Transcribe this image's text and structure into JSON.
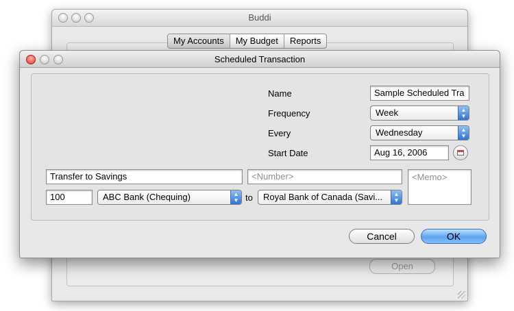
{
  "main_window": {
    "title": "Buddi",
    "tabs": [
      "My Accounts",
      "My Budget",
      "Reports"
    ],
    "open_button": "Open"
  },
  "dialog": {
    "title": "Scheduled Transaction",
    "name_label": "Name",
    "name_value": "Sample Scheduled Tra",
    "frequency_label": "Frequency",
    "frequency_value": "Week",
    "every_label": "Every",
    "every_value": "Wednesday",
    "start_date_label": "Start Date",
    "start_date_value": "Aug 16, 2006",
    "description_value": "Transfer to Savings",
    "number_placeholder": "<Number>",
    "memo_placeholder": "<Memo>",
    "amount_value": "100",
    "from_account": "ABC Bank (Chequing)",
    "to_label": "to",
    "to_account": "Royal Bank of Canada (Savi...",
    "cancel_label": "Cancel",
    "ok_label": "OK"
  },
  "icons": {
    "close": "close-icon",
    "calendar": "calendar-icon",
    "popup_arrows": "updown-arrows-icon",
    "resize": "resize-grip-icon"
  },
  "colors": {
    "accent_blue": "#5ea3ee",
    "close_red": "#d83a2c",
    "window_bg": "#e8e8e8"
  }
}
